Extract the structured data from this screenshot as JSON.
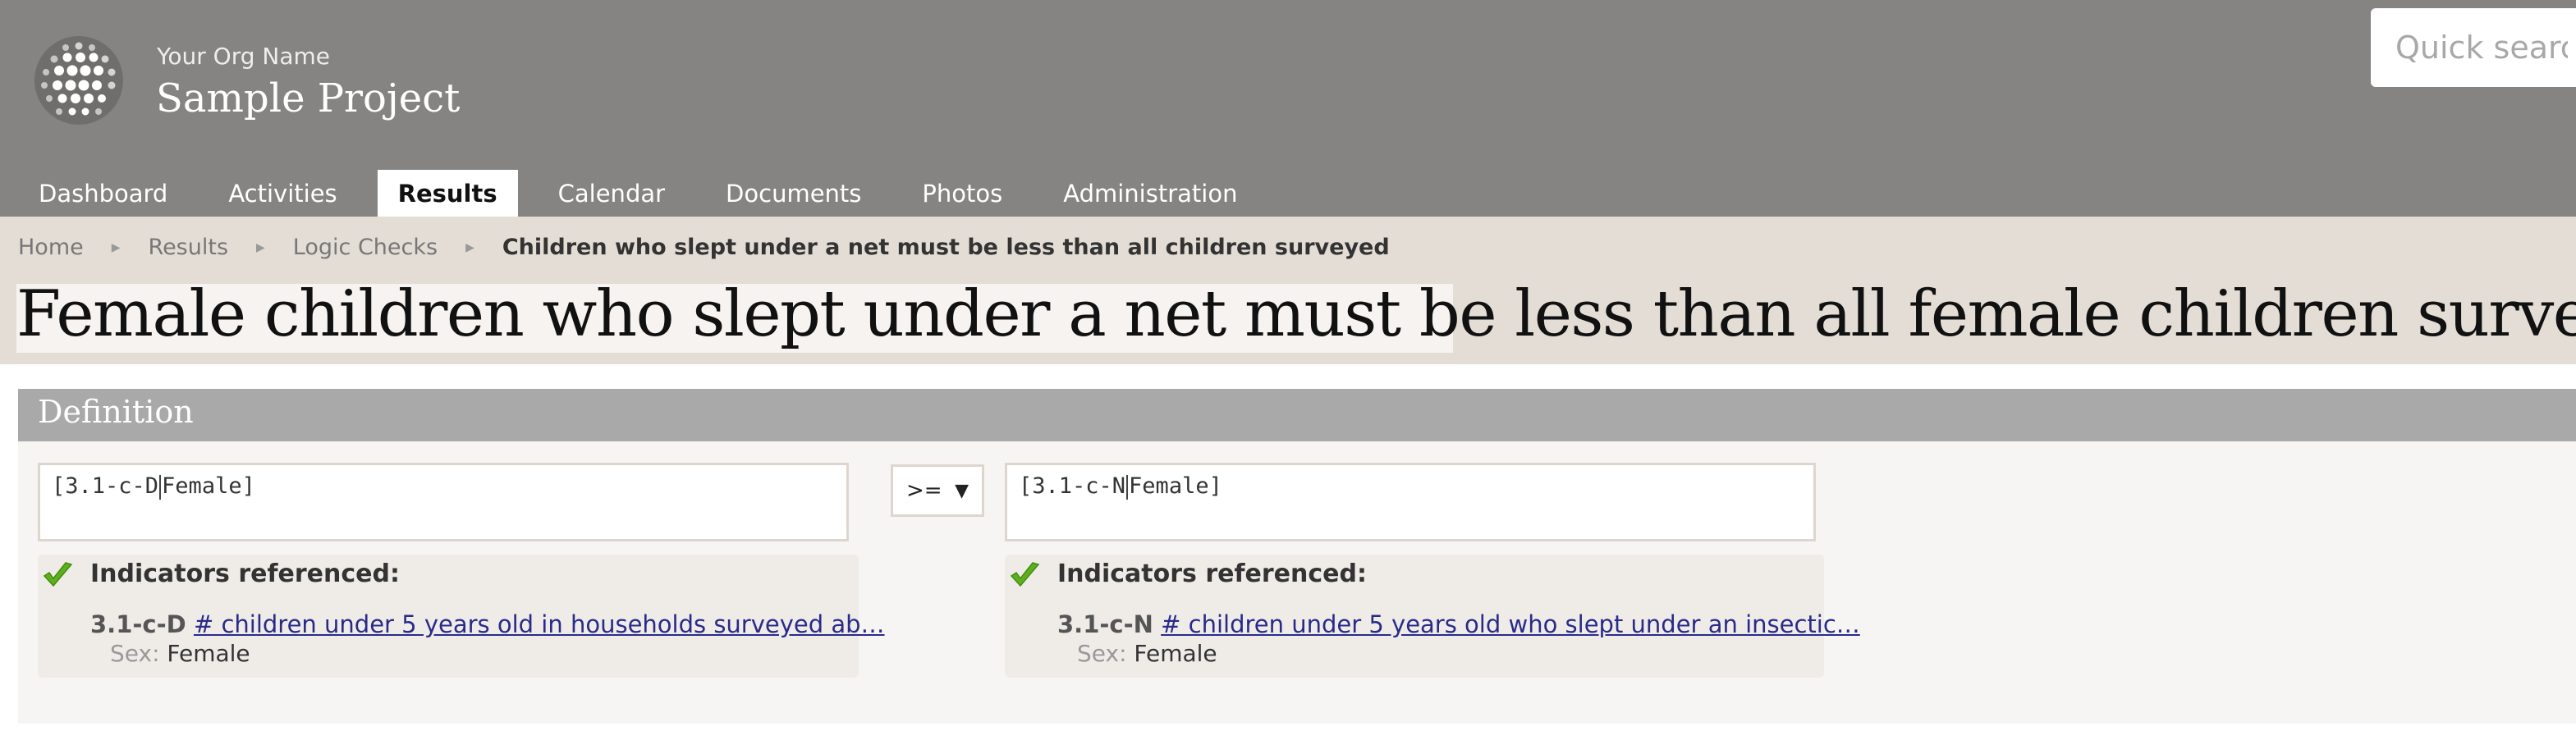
{
  "header": {
    "org_name": "Your Org Name",
    "project_name": "Sample Project",
    "search_placeholder": "Quick search"
  },
  "nav": {
    "items": [
      {
        "label": "Dashboard"
      },
      {
        "label": "Activities"
      },
      {
        "label": "Results",
        "active": true
      },
      {
        "label": "Calendar"
      },
      {
        "label": "Documents"
      },
      {
        "label": "Photos"
      },
      {
        "label": "Administration"
      }
    ]
  },
  "breadcrumb": {
    "items": [
      "Home",
      "Results",
      "Logic Checks"
    ],
    "current": "Children who slept under a net must be less than all children surveyed"
  },
  "page": {
    "title": "Female children who slept under a net must be less than all female children surveyed"
  },
  "definition": {
    "heading": "Definition",
    "left": {
      "expression_code": "[3.1-c-D",
      "expression_filter": "Female]",
      "refs_heading": "Indicators referenced:",
      "indicator_code": "3.1-c-D",
      "indicator_name": "# children under 5 years old in households surveyed ab…",
      "sex_label": "Sex:",
      "sex_value": "Female"
    },
    "operator": ">=",
    "right": {
      "expression_code": "[3.1-c-N",
      "expression_filter": "Female]",
      "refs_heading": "Indicators referenced:",
      "indicator_code": "3.1-c-N",
      "indicator_name": "# children under 5 years old who slept under an insectic…",
      "sex_label": "Sex:",
      "sex_value": "Female"
    }
  },
  "colors": {
    "header_bg": "#858482",
    "band_bg": "#e4ddd6",
    "panel_head_bg": "#a9a9a9",
    "link": "#2a2a8a",
    "check_green": "#5fae1e"
  },
  "icons": {
    "logo": "globe-dots-logo",
    "check": "check-icon",
    "breadcrumb_separator": "triangle-right-icon",
    "dropdown": "triangle-down-icon"
  }
}
